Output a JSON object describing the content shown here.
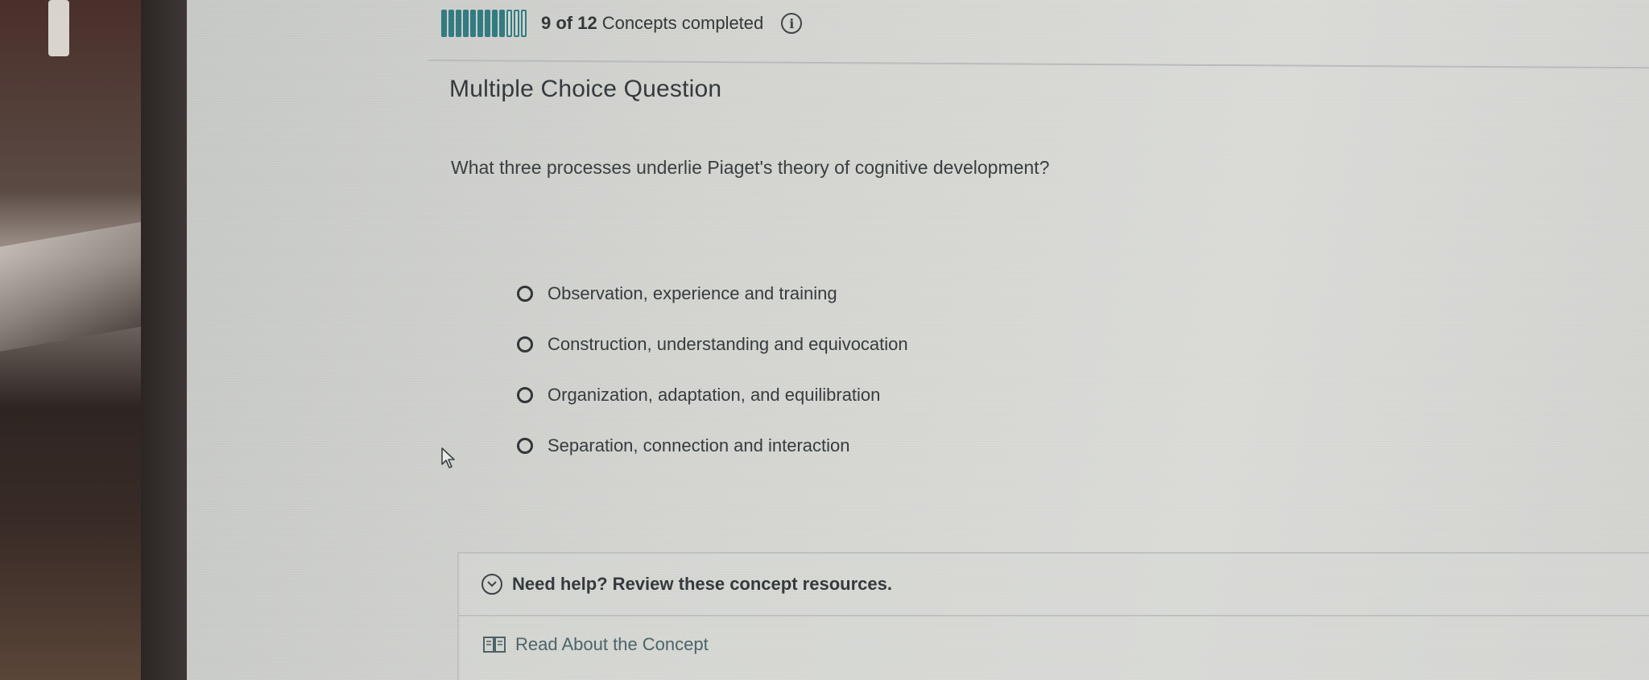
{
  "progress": {
    "completed": 9,
    "total": 12,
    "count_text": "9 of 12",
    "label": "Concepts completed",
    "bar_color": "#2f7a80",
    "info_icon": "info-icon"
  },
  "question": {
    "type_label": "Multiple Choice Question",
    "prompt": "What three processes underlie Piaget's theory of cognitive development?",
    "options": [
      {
        "label": "Observation, experience and training",
        "selected": false
      },
      {
        "label": "Construction, understanding and equivocation",
        "selected": false
      },
      {
        "label": "Organization, adaptation, and equilibration",
        "selected": false
      },
      {
        "label": "Separation, connection and interaction",
        "selected": false
      }
    ]
  },
  "help": {
    "title": "Need help? Review these concept resources.",
    "expand_icon": "chevron-down-circle-icon",
    "resources": [
      {
        "label": "Read About the Concept",
        "icon": "book-icon"
      }
    ]
  }
}
